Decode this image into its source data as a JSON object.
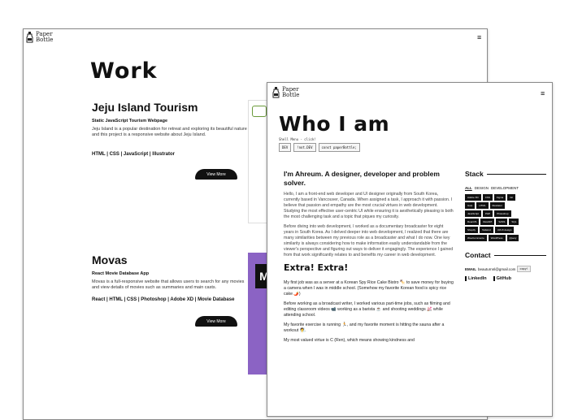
{
  "logo": {
    "line1": "Paper",
    "line2": "Bottle",
    "icon": "bottle-logo-icon"
  },
  "menu_icon": "hamburger-menu-icon",
  "work_page": {
    "title": "Work",
    "projects": [
      {
        "title": "Jeju Island Tourism",
        "subtitle": "Static JavaScript Tourism Webpage",
        "description": "Jeju Island is a popular destination for retreat and exploring its beautiful nature and this project is a responsive website about Jeju Island.",
        "tech": "HTML | CSS | JavaScript | Illustrator",
        "button": "View More"
      },
      {
        "title": "Movas",
        "subtitle": "React Movie Database App",
        "description": "Movas is a full-responsive website that allows users to search for any movies and view details of movies such as summaries and main casts.",
        "tech": "React | HTML | CSS | Photoshop | Adobe XD | Movie Database",
        "button": "View More",
        "thumb_letter": "M"
      }
    ]
  },
  "about_page": {
    "title": "Who I am",
    "shell_label": "Shell Menu - click!",
    "commands": [
      "DEV",
      "!not.DEV",
      "const paperBottle;"
    ],
    "intro": "I'm Ahreum. A designer, developer and problem solver.",
    "paragraphs": [
      "Hello, I am a front-end web developer and UI designer originally from South Korea, currently based in Vancouver, Canada. When assigned a task, I approach it with passion. I believe that passion and empathy are the most crucial virtues in web development. Studying the most effective user-centric UI while ensuring it is aesthetically pleasing is both the most challenging task and a topic that piques my curiosity.",
      "Before diving into web development, I worked as a documentary broadcaster for eight years in South Korea. As I delved deeper into web development, I realized that there are many similarities between my previous role as a broadcaster and what I do now. One key similarity is always considering how to make information easily understandable from the viewer's perspective and figuring out ways to deliver it engagingly. The experience I gained from that work significantly relates to and benefits my career in web development."
    ],
    "extra_title": "Extra! Extra!",
    "extra_paragraphs": [
      "My first job was as a server at a Korean Spy Rice Cake Bistro 🍢 to save money for buying a camera when I was in middle school. (Somehow my favorite Korean food is spicy rice cake 🌶️)",
      "Before working as a broadcast writer, I worked various part-time jobs, such as filming and editing classroom videos 📹 working as a barista ☕ and shooting weddings 💒 while attending school.",
      "My favorite exercise is running 🏃, and my favorite moment is hitting the sauna after a workout 🧖.",
      "My most valued virtue is C (Ren), which means showing kindness and"
    ],
    "stack": {
      "title": "Stack",
      "filters": [
        "ALL",
        "DESIGN",
        "DEVELOPMENT"
      ],
      "active_filter": "ALL",
      "tags": [
        "Adobe XD",
        "CSS",
        "Figma",
        "Git",
        "Gulp",
        "HTML",
        "Illustrator",
        "JavaScript",
        "PHP",
        "Photoshop",
        "ReactJS",
        "RestAPI",
        "SASS",
        "SQL",
        "Shopify",
        "Tailwind",
        "UI/UX design",
        "WooCommerce",
        "WordPress",
        "jQuery"
      ]
    },
    "contact": {
      "title": "Contact",
      "email_label": "EMAIL",
      "email": "beauturnnl@gmail.com",
      "copy_label": "copy!",
      "links": [
        "LinkedIn",
        "GitHub"
      ]
    }
  }
}
